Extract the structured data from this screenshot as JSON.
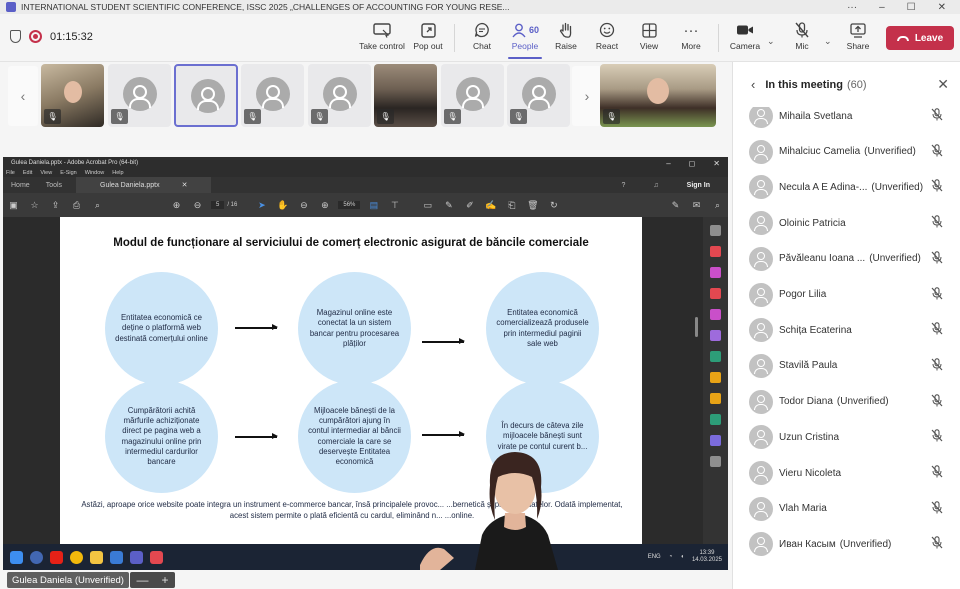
{
  "window": {
    "title": "INTERNATIONAL STUDENT SCIENTIFIC CONFERENCE, ISSC 2025 „CHALLENGES OF ACCOUNTING FOR YOUNG RESE..."
  },
  "meeting": {
    "timer": "01:15:32",
    "toolbar": {
      "take_control": "Take control",
      "pop_out": "Pop out",
      "chat": "Chat",
      "people": "People",
      "people_count": "60",
      "raise": "Raise",
      "react": "React",
      "view": "View",
      "more": "More",
      "camera": "Camera",
      "mic": "Mic",
      "share": "Share",
      "leave": "Leave"
    }
  },
  "shared_screen": {
    "acrobat": {
      "window_title": "Gulea Daniela.pptx - Adobe Acrobat Pro (64-bit)",
      "menu": [
        "File",
        "Edit",
        "View",
        "E-Sign",
        "Window",
        "Help"
      ],
      "tabs": {
        "home": "Home",
        "tools": "Tools",
        "document": "Gulea Daniela.pptx"
      },
      "sign_in": "Sign In",
      "page_current": "5",
      "page_total": "/ 16",
      "zoom": "56%"
    },
    "slide": {
      "title": "Modul de funcționare al serviciului de comerț electronic asigurat de băncile comerciale",
      "circles": [
        "Entitatea economică ce deține o platformă web destinată comerțului online",
        "Magazinul online este conectat la un sistem bancar pentru procesarea plăților",
        "Entitatea economică comercializează produsele prin intermediul paginii sale web",
        "Cumpărătorii achită mărfurile achiziționate direct pe pagina web a magazinului online prin intermediul cardurilor bancare",
        "Mijloacele bănești de la cumpărători ajung în contul intermediar al băncii comerciale la care se deservește Entitatea economică",
        "În decurs de câteva zile mijloacele bănești sunt virate pe contul curent b..."
      ],
      "bottom_text": "Astăzi, aproape orice website poate integra un instrument e-commerce bancar, însă principalele provoc... ...bernetică și protecția datelor. Odată implementat, acest sistem permite o plată eficientă cu cardul, eliminând n... ...online."
    },
    "taskbar": {
      "lang": "ENG",
      "time": "13:39",
      "date": "14.03.2025"
    },
    "presenter_label": "Gulea Daniela (Unverified)",
    "zoom_minus": "—",
    "zoom_plus": "+"
  },
  "panel": {
    "title": "In this meeting",
    "count": "(60)",
    "participants": [
      {
        "name": "Mihaila Svetlana",
        "unverified": ""
      },
      {
        "name": "Mihalciuc Camelia",
        "unverified": "(Unverified)"
      },
      {
        "name": "Necula A E Adina-...",
        "unverified": "(Unverified)"
      },
      {
        "name": "Oloinic Patricia",
        "unverified": ""
      },
      {
        "name": "Păvăleanu Ioana ...",
        "unverified": "(Unverified)"
      },
      {
        "name": "Pogor Lilia",
        "unverified": ""
      },
      {
        "name": "Schița Ecaterina",
        "unverified": ""
      },
      {
        "name": "Stavilă Paula",
        "unverified": ""
      },
      {
        "name": "Todor Diana",
        "unverified": "(Unverified)"
      },
      {
        "name": "Uzun Cristina",
        "unverified": ""
      },
      {
        "name": "Vieru Nicoleta",
        "unverified": ""
      },
      {
        "name": "Vlah Maria",
        "unverified": ""
      },
      {
        "name": "Иван Касым",
        "unverified": "(Unverified)"
      }
    ]
  }
}
